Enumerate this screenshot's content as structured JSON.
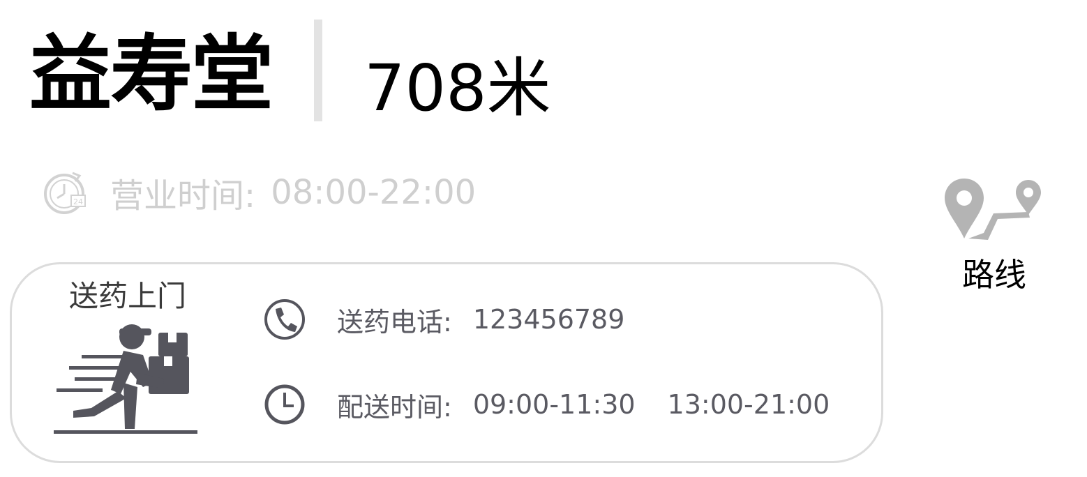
{
  "store": {
    "name": "益寿堂",
    "distance": "708米"
  },
  "hours": {
    "icon": "clock-24-icon",
    "label": "营业时间:",
    "value": "08:00-22:00"
  },
  "route": {
    "icon": "route-pin-icon",
    "label": "路线"
  },
  "delivery": {
    "title": "送药上门",
    "illustration": "courier-icon",
    "phone": {
      "icon": "phone-icon",
      "label": "送药电话:",
      "value": "123456789"
    },
    "time": {
      "icon": "clock-icon",
      "label": "配送时间:",
      "slot1": "09:00-11:30",
      "slot2": "13:00-21:00"
    }
  },
  "colors": {
    "muted_text": "#cfcfcf",
    "icon_gray": "#b4b4b4",
    "card_border": "#dcdcdc",
    "dark_gray": "#55555d"
  }
}
